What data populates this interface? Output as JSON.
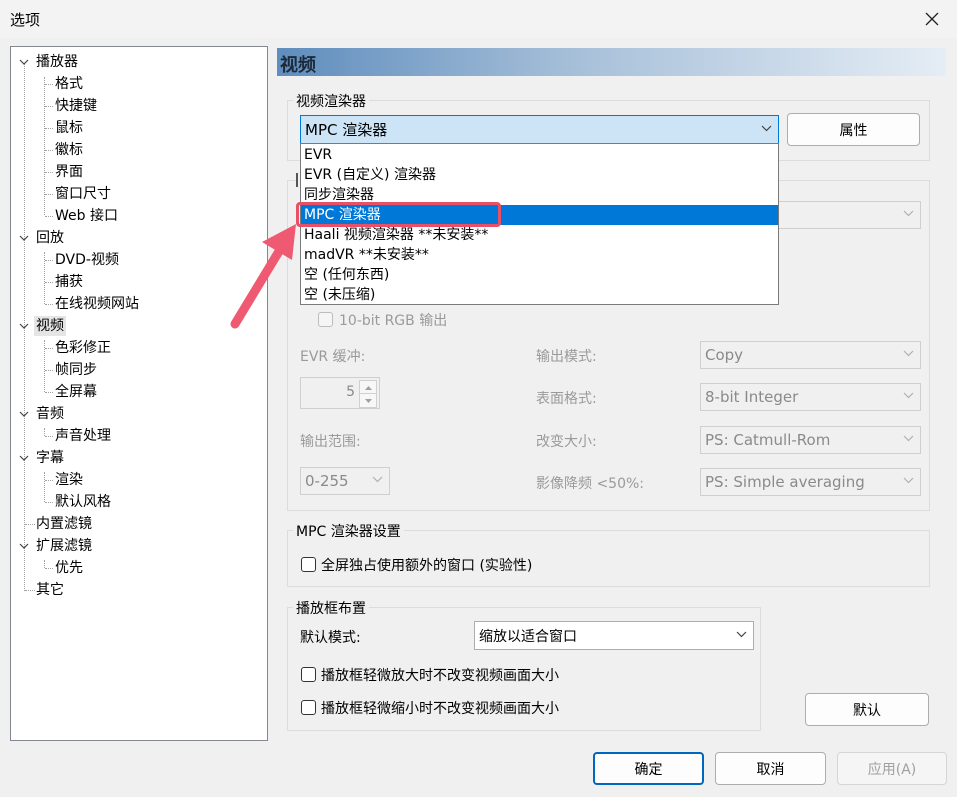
{
  "window": {
    "title": "选项"
  },
  "tree": {
    "items": [
      {
        "label": "播放器"
      },
      {
        "label": "格式"
      },
      {
        "label": "快捷键"
      },
      {
        "label": "鼠标"
      },
      {
        "label": "徽标"
      },
      {
        "label": "界面"
      },
      {
        "label": "窗口尺寸"
      },
      {
        "label": "Web 接口"
      },
      {
        "label": "回放"
      },
      {
        "label": "DVD-视频"
      },
      {
        "label": "捕获"
      },
      {
        "label": "在线视频网站"
      },
      {
        "label": "视频"
      },
      {
        "label": "色彩修正"
      },
      {
        "label": "帧同步"
      },
      {
        "label": "全屏幕"
      },
      {
        "label": "音频"
      },
      {
        "label": "声音处理"
      },
      {
        "label": "字幕"
      },
      {
        "label": "渲染"
      },
      {
        "label": "默认风格"
      },
      {
        "label": "内置滤镜"
      },
      {
        "label": "扩展滤镜"
      },
      {
        "label": "优先"
      },
      {
        "label": "其它"
      }
    ]
  },
  "page": {
    "heading": "视频"
  },
  "renderer": {
    "group_label": "视频渲染器",
    "selected": "MPC 渲染器",
    "properties_button": "属性",
    "options": [
      "EVR",
      "EVR (自定义) 渲染器",
      "同步渲染器",
      "MPC 渲染器",
      "Haali 视频渲染器 **未安装**",
      "madVR **未安装**",
      "空 (任何东西)",
      "空 (未压缩)"
    ]
  },
  "dx": {
    "ten_bit_rgb": "10-bit RGB 输出",
    "evr_buffer_label": "EVR 缓冲:",
    "evr_buffer_value": "5",
    "output_range_label": "输出范围:",
    "output_range_value": "0-255",
    "output_mode_label": "输出模式:",
    "output_mode_value": "Copy",
    "surface_format_label": "表面格式:",
    "surface_format_value": "8-bit Integer",
    "resize_label": "改变大小:",
    "resize_value": "PS: Catmull-Rom",
    "downscale_label": "影像降频 <50%:",
    "downscale_value": "PS: Simple averaging"
  },
  "mpc_settings": {
    "group_label": "MPC 渲染器设置",
    "fullscreen_option": "全屏独占使用额外的窗口 (实验性)"
  },
  "layout": {
    "group_label": "播放框布置",
    "default_mode_label": "默认模式:",
    "default_mode_value": "缩放以适合窗口",
    "no_zoom_in": "播放框轻微放大时不改变视频画面大小",
    "no_zoom_out": "播放框轻微缩小时不改变视频画面大小",
    "default_button": "默认"
  },
  "footer": {
    "ok": "确定",
    "cancel": "取消",
    "apply": "应用(A)"
  },
  "colors": {
    "selection": "#0078d7",
    "highlight_box": "#e8506a",
    "arrow": "#ef5a72"
  }
}
